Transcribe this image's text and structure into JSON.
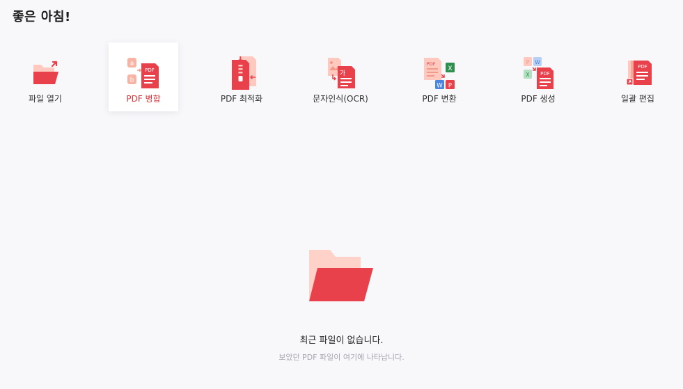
{
  "greeting": "좋은 아침!",
  "tools": [
    {
      "id": "open",
      "label": "파일 열기",
      "icon": "open-folder-icon",
      "active": false
    },
    {
      "id": "merge",
      "label": "PDF 병합",
      "icon": "merge-pdf-icon",
      "active": true
    },
    {
      "id": "optimize",
      "label": "PDF 최적화",
      "icon": "compress-pdf-icon",
      "active": false
    },
    {
      "id": "ocr",
      "label": "문자인식(OCR)",
      "icon": "ocr-icon",
      "active": false
    },
    {
      "id": "convert",
      "label": "PDF 변환",
      "icon": "convert-pdf-icon",
      "active": false
    },
    {
      "id": "create",
      "label": "PDF 생성",
      "icon": "create-pdf-icon",
      "active": false
    },
    {
      "id": "batch",
      "label": "일괄 편집",
      "icon": "batch-edit-icon",
      "active": false
    }
  ],
  "icon_text": {
    "pdf": "PDF",
    "a": "a",
    "b": "b",
    "ga": "가",
    "x": "X",
    "w": "W",
    "p": "P"
  },
  "empty_state": {
    "title": "최근 파일이 없습니다.",
    "subtitle": "보았던 PDF 파일이 여기에 나타납니다.",
    "icon": "empty-folder-icon"
  },
  "colors": {
    "accent": "#e8414b",
    "accent_light": "#ffc9c0",
    "background": "#f8f8fb",
    "excel_green": "#2f8f4e",
    "word_blue": "#4a86e0"
  }
}
